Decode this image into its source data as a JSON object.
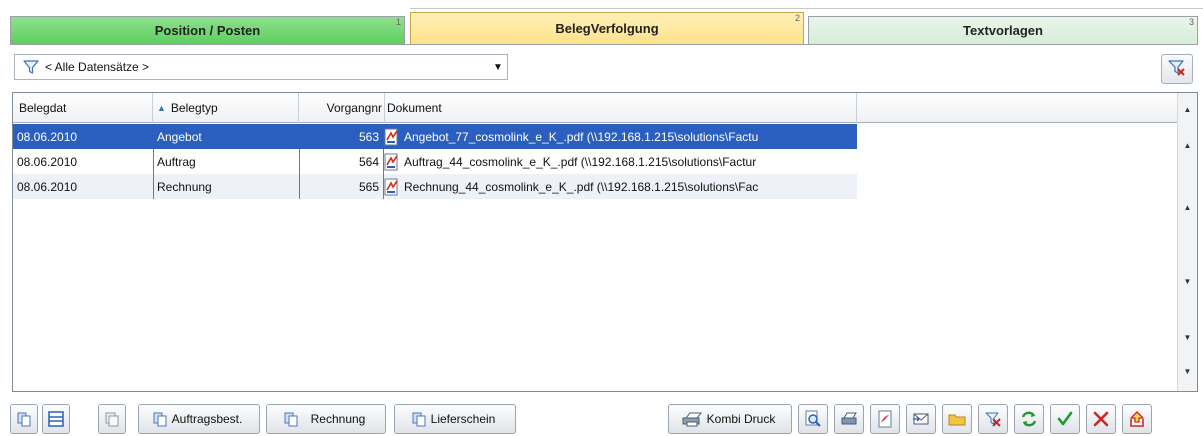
{
  "tabs": [
    {
      "label": "Position / Posten",
      "number": "1"
    },
    {
      "label": "BelegVerfolgung",
      "number": "2"
    },
    {
      "label": "Textvorlagen",
      "number": "3"
    }
  ],
  "filter": {
    "selected": "< Alle Datensätze >",
    "icon": "funnel-icon",
    "clear_button_icon": "clear-filter-icon"
  },
  "grid": {
    "columns": {
      "belegdat": "Belegdat",
      "belegtyp": "Belegtyp",
      "vorgangnr": "Vorgangnr",
      "dokument": "Dokument"
    },
    "sorted_column": "belegtyp",
    "sort_direction": "ascending",
    "rows": [
      {
        "belegdat": "08.06.2010",
        "belegtyp": "Angebot",
        "vorgangnr": "563",
        "dokument": "Angebot_77_cosmolink_e_K_.pdf (\\\\192.168.1.215\\solutions\\Factu",
        "selected": true
      },
      {
        "belegdat": "08.06.2010",
        "belegtyp": "Auftrag",
        "vorgangnr": "564",
        "dokument": "Auftrag_44_cosmolink_e_K_.pdf (\\\\192.168.1.215\\solutions\\Factur",
        "selected": false
      },
      {
        "belegdat": "08.06.2010",
        "belegtyp": "Rechnung",
        "vorgangnr": "565",
        "dokument": "Rechnung_44_cosmolink_e_K_.pdf (\\\\192.168.1.215\\solutions\\Fac",
        "selected": false
      }
    ]
  },
  "toolbar": {
    "auftragsbest_label": "Auftragsbest.",
    "rechnung_label": "Rechnung",
    "lieferschein_label": "Lieferschein",
    "kombi_druck_label": "Kombi Druck"
  },
  "colors": {
    "selection": "#2a5fbf",
    "tab_active": "#fde28a",
    "tab_green": "#5ecf5e",
    "tab_light_green": "#d6ecd8"
  }
}
